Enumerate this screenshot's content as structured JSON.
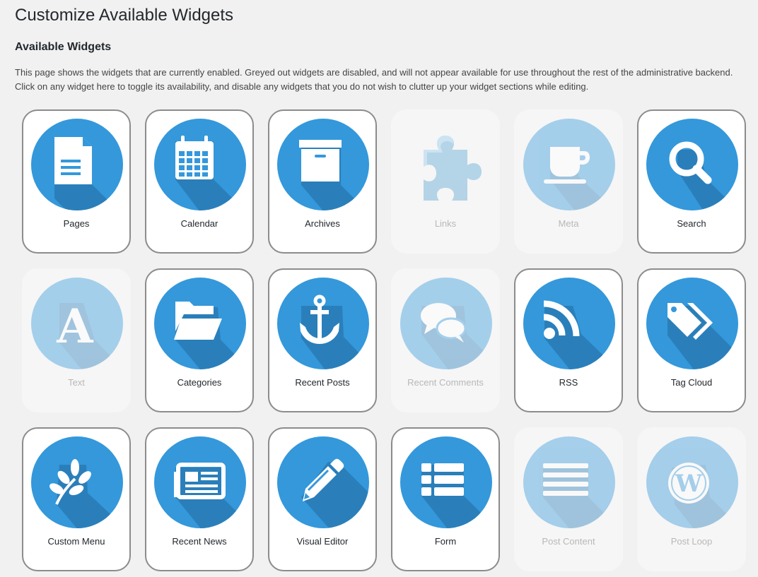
{
  "page": {
    "title": "Customize Available Widgets",
    "section_title": "Available Widgets",
    "description": "This page shows the widgets that are currently enabled. Greyed out widgets are disabled, and will not appear available for use throughout the rest of the administrative backend. Click on any widget here to toggle its availability, and disable any widgets that you do not wish to clutter up your widget sections while editing."
  },
  "colors": {
    "accent": "#3498db",
    "shadow": "#2a7fba",
    "icon": "#ffffff"
  },
  "widgets": [
    {
      "label": "Pages",
      "icon": "document-icon",
      "enabled": true
    },
    {
      "label": "Calendar",
      "icon": "calendar-icon",
      "enabled": true
    },
    {
      "label": "Archives",
      "icon": "archive-box-icon",
      "enabled": true
    },
    {
      "label": "Links",
      "icon": "puzzle-piece-icon",
      "enabled": false
    },
    {
      "label": "Meta",
      "icon": "coffee-cup-icon",
      "enabled": false
    },
    {
      "label": "Search",
      "icon": "magnifier-icon",
      "enabled": true
    },
    {
      "label": "Text",
      "icon": "letter-a-icon",
      "enabled": false
    },
    {
      "label": "Categories",
      "icon": "folder-icon",
      "enabled": true
    },
    {
      "label": "Recent Posts",
      "icon": "anchor-icon",
      "enabled": true
    },
    {
      "label": "Recent Comments",
      "icon": "speech-bubbles-icon",
      "enabled": false
    },
    {
      "label": "RSS",
      "icon": "rss-icon",
      "enabled": true
    },
    {
      "label": "Tag Cloud",
      "icon": "tags-icon",
      "enabled": true
    },
    {
      "label": "Custom Menu",
      "icon": "leaf-branch-icon",
      "enabled": true
    },
    {
      "label": "Recent News",
      "icon": "newspaper-icon",
      "enabled": true
    },
    {
      "label": "Visual Editor",
      "icon": "pencil-icon",
      "enabled": true
    },
    {
      "label": "Form",
      "icon": "list-icon",
      "enabled": true
    },
    {
      "label": "Post Content",
      "icon": "text-lines-icon",
      "enabled": false
    },
    {
      "label": "Post Loop",
      "icon": "wordpress-icon",
      "enabled": false
    }
  ]
}
